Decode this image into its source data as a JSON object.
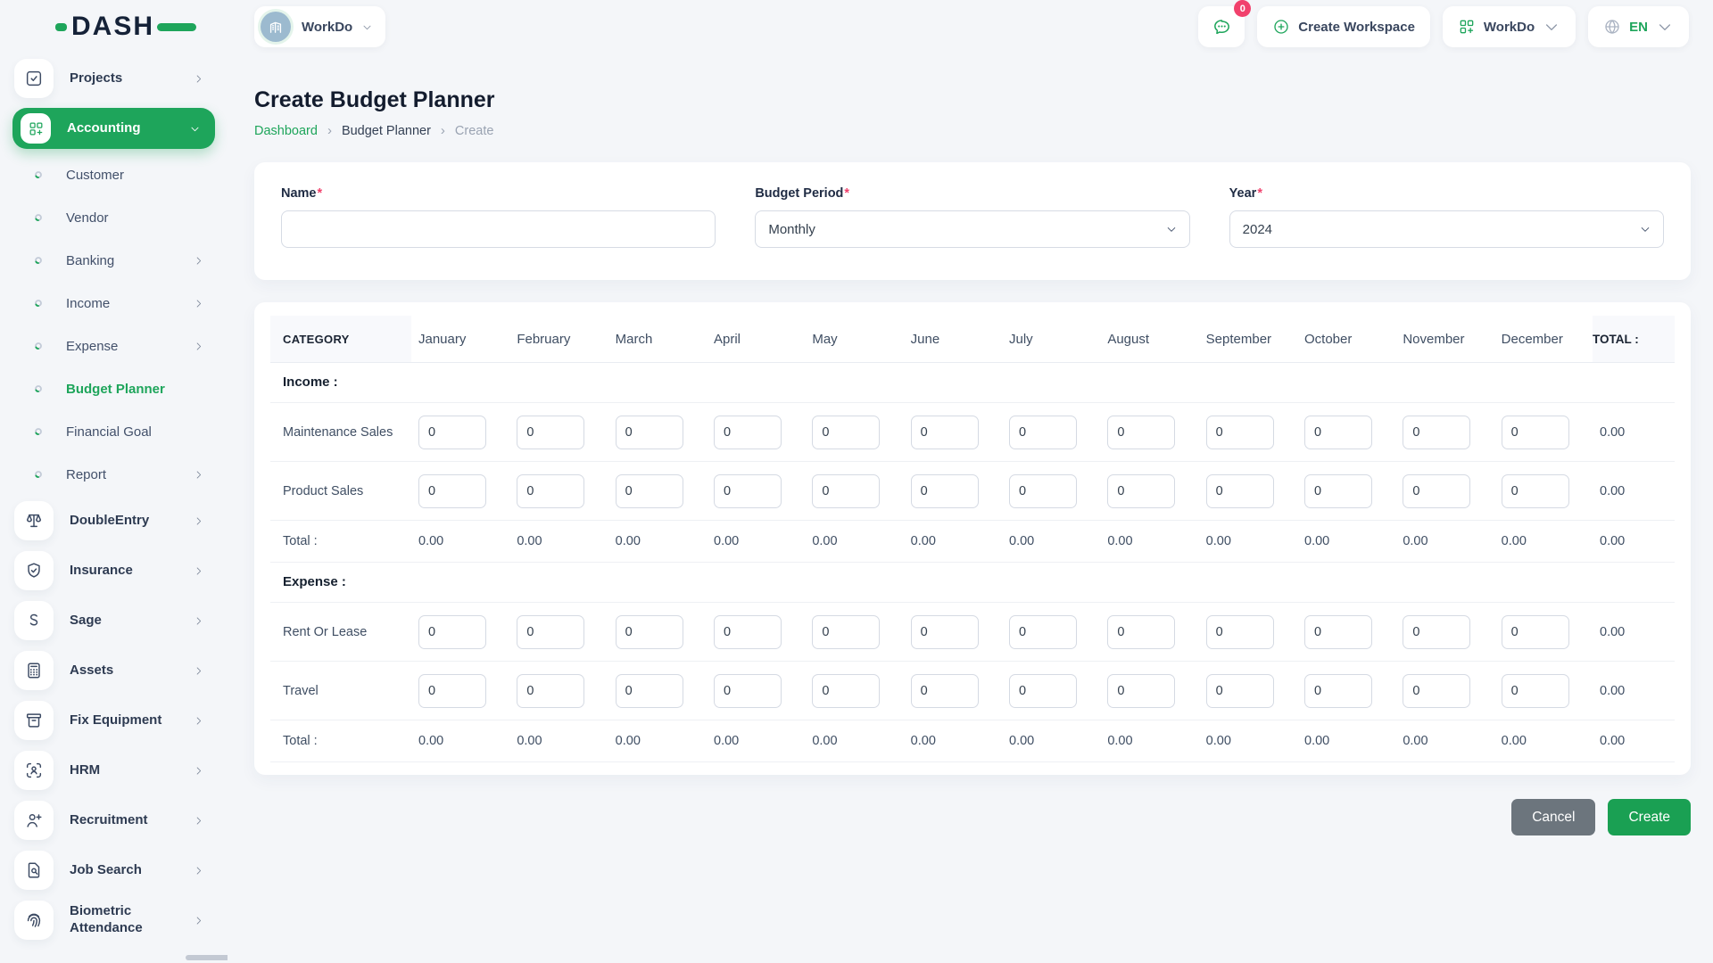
{
  "brand": {
    "name": "DASH"
  },
  "topbar": {
    "workspace_switcher": {
      "label": "WorkDo"
    },
    "messages": {
      "badge": "0"
    },
    "create_workspace_label": "Create Workspace",
    "company_menu_label": "WorkDo",
    "language": "EN"
  },
  "sidebar": {
    "items": [
      {
        "type": "main",
        "label": "Projects",
        "icon": "checkbox",
        "chevron": true
      },
      {
        "type": "active",
        "label": "Accounting",
        "icon": "grid-plus",
        "chevron": true
      },
      {
        "type": "sub",
        "label": "Customer",
        "chevron": false,
        "active": false
      },
      {
        "type": "sub",
        "label": "Vendor",
        "chevron": false,
        "active": false
      },
      {
        "type": "sub",
        "label": "Banking",
        "chevron": true,
        "active": false
      },
      {
        "type": "sub",
        "label": "Income",
        "chevron": true,
        "active": false
      },
      {
        "type": "sub",
        "label": "Expense",
        "chevron": true,
        "active": false
      },
      {
        "type": "sub",
        "label": "Budget Planner",
        "chevron": false,
        "active": true
      },
      {
        "type": "sub",
        "label": "Financial Goal",
        "chevron": false,
        "active": false
      },
      {
        "type": "sub",
        "label": "Report",
        "chevron": true,
        "active": false
      },
      {
        "type": "main",
        "label": "DoubleEntry",
        "icon": "scale",
        "chevron": true
      },
      {
        "type": "main",
        "label": "Insurance",
        "icon": "shield-check",
        "chevron": true
      },
      {
        "type": "main",
        "label": "Sage",
        "icon": "letter-s",
        "chevron": true
      },
      {
        "type": "main",
        "label": "Assets",
        "icon": "calculator",
        "chevron": true
      },
      {
        "type": "main",
        "label": "Fix Equipment",
        "icon": "archive-box",
        "chevron": true
      },
      {
        "type": "main",
        "label": "HRM",
        "icon": "person-frame",
        "chevron": true
      },
      {
        "type": "main",
        "label": "Recruitment",
        "icon": "person-plus",
        "chevron": true
      },
      {
        "type": "main",
        "label": "Job Search",
        "icon": "document-search",
        "chevron": true
      },
      {
        "type": "main",
        "label": "Biometric Attendance",
        "icon": "fingerprint",
        "chevron": true
      }
    ]
  },
  "page": {
    "title": "Create Budget Planner",
    "breadcrumb": [
      "Dashboard",
      "Budget Planner",
      "Create"
    ],
    "breadcrumb_separator": "›"
  },
  "form": {
    "required_mark": "*",
    "fields": [
      {
        "label": "Name",
        "control": "text",
        "value": "",
        "placeholder": ""
      },
      {
        "label": "Budget Period",
        "control": "select",
        "value": "Monthly"
      },
      {
        "label": "Year",
        "control": "select",
        "value": "2024"
      }
    ]
  },
  "table": {
    "category_header": "CATEGORY",
    "total_header": "TOTAL :",
    "months": [
      "January",
      "February",
      "March",
      "April",
      "May",
      "June",
      "July",
      "August",
      "September",
      "October",
      "November",
      "December"
    ],
    "sections": [
      {
        "title": "Income :",
        "rows": [
          {
            "label": "Maintenance Sales",
            "values": [
              "0",
              "0",
              "0",
              "0",
              "0",
              "0",
              "0",
              "0",
              "0",
              "0",
              "0",
              "0"
            ],
            "total": "0.00"
          },
          {
            "label": "Product Sales",
            "values": [
              "0",
              "0",
              "0",
              "0",
              "0",
              "0",
              "0",
              "0",
              "0",
              "0",
              "0",
              "0"
            ],
            "total": "0.00"
          }
        ],
        "total_row": {
          "label": "Total :",
          "values": [
            "0.00",
            "0.00",
            "0.00",
            "0.00",
            "0.00",
            "0.00",
            "0.00",
            "0.00",
            "0.00",
            "0.00",
            "0.00",
            "0.00"
          ],
          "total": "0.00"
        }
      },
      {
        "title": "Expense :",
        "rows": [
          {
            "label": "Rent Or Lease",
            "values": [
              "0",
              "0",
              "0",
              "0",
              "0",
              "0",
              "0",
              "0",
              "0",
              "0",
              "0",
              "0"
            ],
            "total": "0.00"
          },
          {
            "label": "Travel",
            "values": [
              "0",
              "0",
              "0",
              "0",
              "0",
              "0",
              "0",
              "0",
              "0",
              "0",
              "0",
              "0"
            ],
            "total": "0.00"
          }
        ],
        "total_row": {
          "label": "Total :",
          "values": [
            "0.00",
            "0.00",
            "0.00",
            "0.00",
            "0.00",
            "0.00",
            "0.00",
            "0.00",
            "0.00",
            "0.00",
            "0.00",
            "0.00"
          ],
          "total": "0.00"
        }
      }
    ]
  },
  "actions": {
    "cancel_label": "Cancel",
    "create_label": "Create"
  },
  "colors": {
    "primary_green": "#1ea55b",
    "badge_pink": "#f1416c",
    "cancel_gray": "#6c757d"
  }
}
